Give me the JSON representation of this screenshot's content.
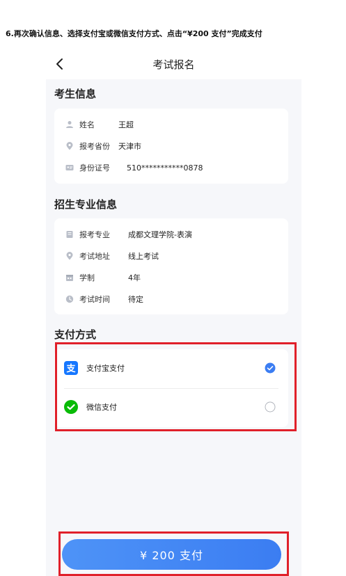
{
  "instruction": "6.再次确认信息、选择支付宝或微信支付方式、点击“¥200 支付”完成支付",
  "navbar": {
    "title": "考试报名"
  },
  "candidate": {
    "section_title": "考生信息",
    "rows": [
      {
        "icon": "person-icon",
        "label": "姓名",
        "value": "王超"
      },
      {
        "icon": "location-icon",
        "label": "报考省份",
        "value": "天津市"
      },
      {
        "icon": "id-card-icon",
        "label": "身份证号",
        "value": "510***********0878"
      }
    ]
  },
  "major": {
    "section_title": "招生专业信息",
    "rows": [
      {
        "icon": "book-icon",
        "label": "报考专业",
        "value": "成都文理学院-表演"
      },
      {
        "icon": "location-icon",
        "label": "考试地址",
        "value": "线上考试"
      },
      {
        "icon": "calendar-icon",
        "label": "学制",
        "value": "4年"
      },
      {
        "icon": "clock-icon",
        "label": "考试时间",
        "value": "待定"
      }
    ]
  },
  "payment": {
    "section_title": "支付方式",
    "options": [
      {
        "icon": "alipay-icon",
        "label": "支付宝支付",
        "selected": true
      },
      {
        "icon": "wechat-pay-icon",
        "label": "微信支付",
        "selected": false
      }
    ]
  },
  "pay_button": {
    "label": "¥ 200 支付"
  },
  "colors": {
    "accent": "#3b7df2",
    "highlight": "#e0202a",
    "alipay": "#1677ff",
    "wechat": "#09bb07"
  }
}
